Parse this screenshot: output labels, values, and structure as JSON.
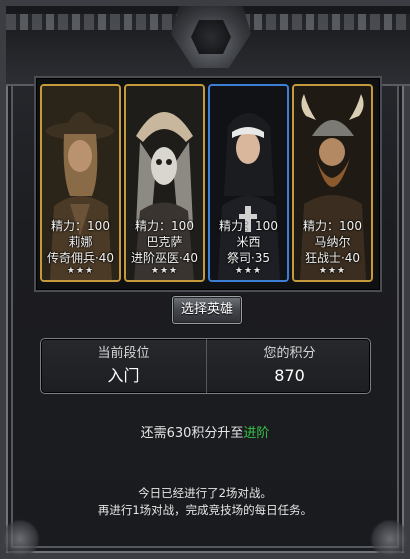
{
  "heroes": [
    {
      "energy": "精力：100",
      "name": "莉娜",
      "class": "传奇佣兵·40",
      "stars": "★★★",
      "frame": "gold",
      "colors": {
        "bg": "#2b2418",
        "hat": "#3d3122",
        "skin": "#b99270",
        "hair": "#8a6b47",
        "coat": "#4b3a26"
      }
    },
    {
      "energy": "精力：100",
      "name": "巴克萨",
      "class": "进阶巫医·40",
      "stars": "★★★",
      "frame": "gold",
      "colors": {
        "bg": "#1e1d1a",
        "hat": "#c8b79c",
        "skin": "#d9d5cf",
        "hair": "#8d8a84",
        "coat": "#3a3430"
      }
    },
    {
      "energy": "精力：100",
      "name": "米西",
      "class": "祭司·35",
      "stars": "★★★",
      "frame": "blue",
      "colors": {
        "bg": "#101216",
        "hat": "#1b1c20",
        "skin": "#d8b79d",
        "hair": "#2a2b30",
        "coat": "#1d1f24"
      }
    },
    {
      "energy": "精力：100",
      "name": "马纳尔",
      "class": "狂战士·40",
      "stars": "★★★",
      "frame": "gold",
      "colors": {
        "bg": "#1f1a13",
        "hat": "#7c7a74",
        "skin": "#b28962",
        "hair": "#8a5a2e",
        "coat": "#3b2e20"
      }
    }
  ],
  "select_button": "选择英雄",
  "rank": {
    "current_label": "当前段位",
    "current_value": "入门",
    "score_label": "您的积分",
    "score_value": "870"
  },
  "need": {
    "prefix": "还需630积分升至",
    "next_rank": "进阶"
  },
  "info_line_1": "今日已经进行了2场对战。",
  "info_line_2": "再进行1场对战，完成竞技场的每日任务。",
  "colors": {
    "gold_frame": "#c49a3c",
    "blue_frame": "#3e7fd6",
    "next_rank_green": "#37c24a"
  }
}
